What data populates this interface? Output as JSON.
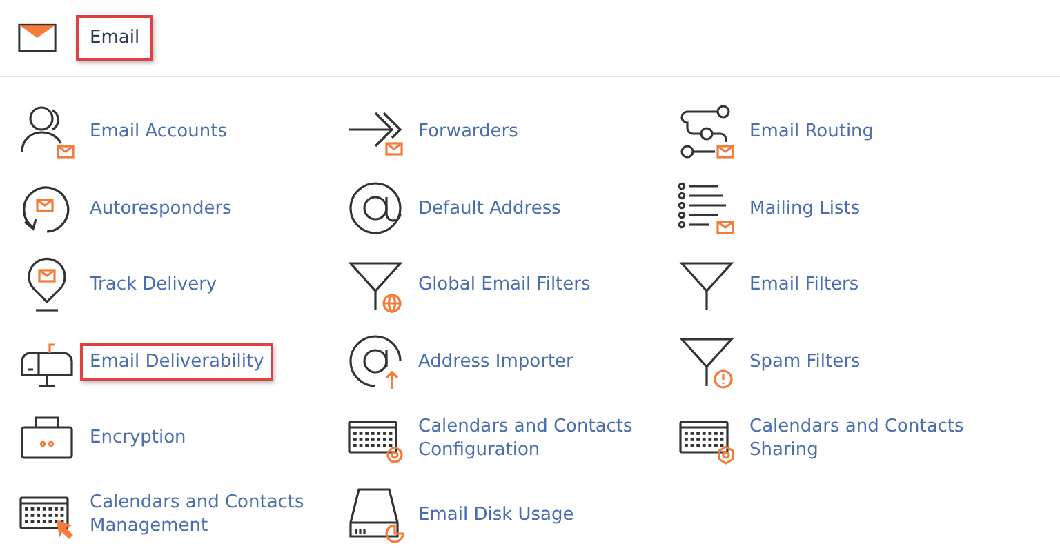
{
  "section": {
    "title": "Email",
    "highlighted": true
  },
  "rows": [
    {
      "items": [
        {
          "label": "Email Accounts",
          "kind": "accounts",
          "highlighted": false
        },
        {
          "label": "Forwarders",
          "kind": "forwarders",
          "highlighted": false
        },
        {
          "label": "Email Routing",
          "kind": "routing",
          "highlighted": false
        }
      ]
    },
    {
      "items": [
        {
          "label": "Autoresponders",
          "kind": "autoresponders",
          "highlighted": false
        },
        {
          "label": "Default Address",
          "kind": "at",
          "highlighted": false
        },
        {
          "label": "Mailing Lists",
          "kind": "lists",
          "highlighted": false
        }
      ]
    },
    {
      "items": [
        {
          "label": "Track Delivery",
          "kind": "track",
          "highlighted": false
        },
        {
          "label": "Global Email Filters",
          "kind": "globalfilter",
          "highlighted": false
        },
        {
          "label": "Email Filters",
          "kind": "filter",
          "highlighted": false
        }
      ]
    },
    {
      "items": [
        {
          "label": "Email Deliverability",
          "kind": "mailbox",
          "highlighted": true
        },
        {
          "label": "Address Importer",
          "kind": "importer",
          "highlighted": false
        },
        {
          "label": "Spam Filters",
          "kind": "spamfilter",
          "highlighted": false
        }
      ]
    },
    {
      "items": [
        {
          "label": "Encryption",
          "kind": "encryption",
          "highlighted": false
        },
        {
          "label": "Calendars and Contacts Configuration",
          "kind": "calat",
          "highlighted": false
        },
        {
          "label": "Calendars and Contacts Sharing",
          "kind": "calgear",
          "highlighted": false
        }
      ]
    },
    {
      "items": [
        {
          "label": "Calendars and Contacts Management",
          "kind": "calcursor",
          "highlighted": false
        },
        {
          "label": "Email Disk Usage",
          "kind": "disk",
          "highlighted": false
        }
      ]
    }
  ]
}
